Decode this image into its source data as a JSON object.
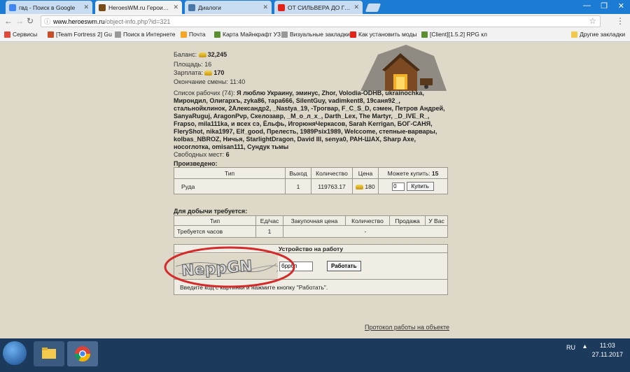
{
  "tabs": [
    {
      "label": "гвд - Поиск в Google",
      "icon_color": "#4285f4"
    },
    {
      "label": "HeroesWM.ru Герои войны и денег",
      "icon_color": "#7a4a16"
    },
    {
      "label": "Диалоги",
      "icon_color": "#4a76a8"
    },
    {
      "label": "ОТ СИЛЬВЕРА ДО ГЛОБАЛА",
      "icon_color": "#e62117"
    }
  ],
  "address": {
    "host": "www.heroeswm.ru",
    "path": "/object-info.php?id=321"
  },
  "bookmarks": [
    {
      "label": "Сервисы"
    },
    {
      "label": "[Team Fortress 2] Gu"
    },
    {
      "label": "Поиск в Интернете"
    },
    {
      "label": "Почта"
    },
    {
      "label": "Карта Майнкрафт УЗ"
    },
    {
      "label": "Визуальные закладки"
    },
    {
      "label": "Как установить моды"
    },
    {
      "label": "[Client][1.5.2] RPG кл"
    },
    {
      "label": "Другие закладки"
    }
  ],
  "info": {
    "balance_label": "Баланс:",
    "balance_value": "32,245",
    "area_label": "Площадь:",
    "area_value": "16",
    "salary_label": "Зарплата:",
    "salary_value": "170",
    "shift_label": "Окончание смены:",
    "shift_value": "11:40"
  },
  "workers": {
    "label": "Список рабочих (74):",
    "names": "Я люблю Украину, эминус, Zhor, Volodia-ODHB, ukrainochka, Мирондил, Олигархъ, zyka86, тара666, SilentGuy, vadimkent8, 19саня92_, стальнойклинок, 2Александр2, _Nastya_19, -Трогвар, F_C_S_D, сэмен, Петров Андрей, SanyaRuguj, AragonPvp, Скелозавр, _М_о_л_х_, Darth_Lex, The Martyr, _D_IVE_R_, Frapso, mila111ka, и всех сэ, Ёльфь, ИгорюняЧеркасов, Sarah Kerrigan, БОГ-САНЯ, FleryShot, nika1997, Elf_good, Прелесть, 1989Psix1989, Welccome, степные-варвары, kolbas_NBROZ, Ничья, StarlightDragon, David III, senya0, РАН-ШАХ, Sharp Axe, носоглотка, omisan111, Сундук тьмы",
    "free_label": "Свободных мест:",
    "free_value": "6"
  },
  "produced": {
    "title": "Произведено:",
    "headers": [
      "Тип",
      "Выход",
      "Количество",
      "Цена",
      "Можете купить:"
    ],
    "can_buy": "15",
    "row": {
      "type": "Руда",
      "output": "1",
      "quantity": "119763.17",
      "price": "180",
      "qty_input": "0"
    },
    "buy_button": "Купить"
  },
  "required": {
    "title": "Для добычи требуется:",
    "headers": [
      "Тип",
      "Ед/час",
      "Закупочная цена",
      "Количество",
      "Продажа",
      "У Вас"
    ],
    "row": {
      "type": "Требуется часов",
      "per_hour": "1",
      "quantity": "-"
    }
  },
  "hire": {
    "title": "Устройство на работу",
    "captcha_text": "NeppGN",
    "code_value": "бррбп",
    "work_button": "Работать",
    "hint": "Введите код с картинки и нажмите кнопку \"Работать\"."
  },
  "protocol_link": "Протокол работы на объекте",
  "taskbar": {
    "lang": "RU",
    "time": "11:03",
    "date": "27.11.2017"
  }
}
